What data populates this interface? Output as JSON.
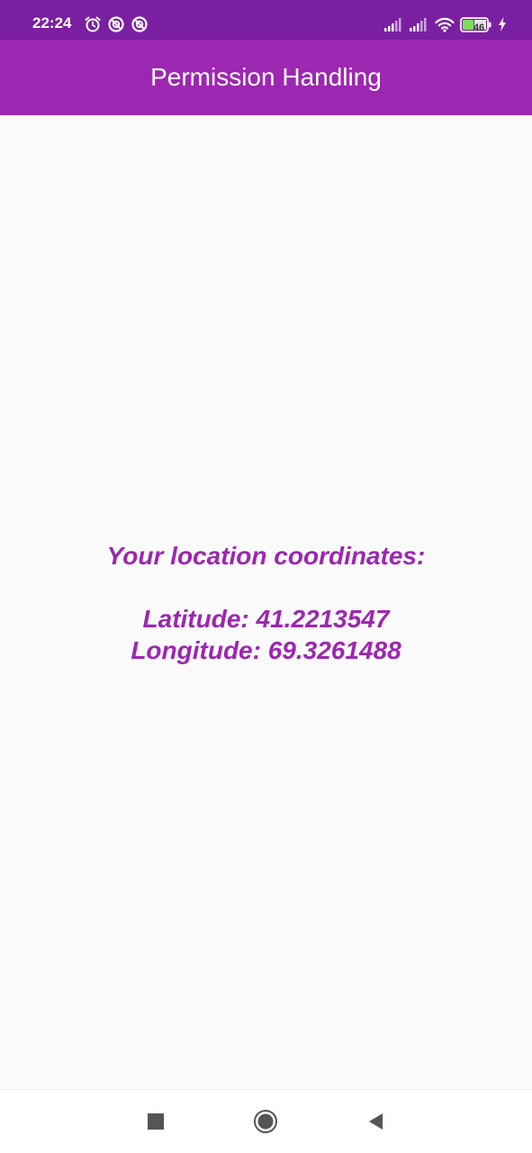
{
  "status_bar": {
    "time": "22:24",
    "left_icons": [
      "alarm-icon",
      "sync-icon",
      "sync-icon"
    ],
    "right_icons": [
      "signal-icon",
      "signal-icon",
      "wifi-icon",
      "battery-icon",
      "charging-icon"
    ],
    "battery_level": "46"
  },
  "app_bar": {
    "title": "Permission Handling"
  },
  "main": {
    "heading": "Your location coordinates:",
    "latitude": "Latitude: 41.2213547",
    "longitude": "Longitude: 69.3261488"
  },
  "nav_bar": {
    "icons": [
      "recents-icon",
      "home-icon",
      "back-icon"
    ]
  },
  "colors": {
    "status_bar": "#7b1fa2",
    "primary": "#9c27b0",
    "background": "#fafafa",
    "nav_bar": "#ffffff"
  }
}
